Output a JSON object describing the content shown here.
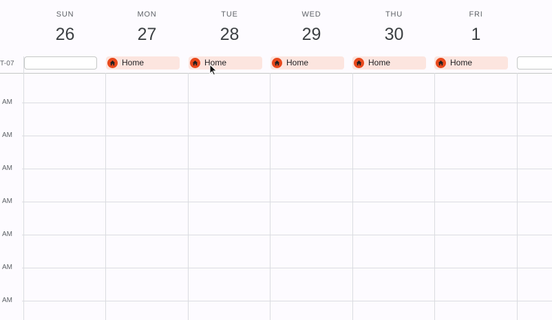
{
  "calendar": {
    "timezone_label": "T-07",
    "days": [
      {
        "name": "SUN",
        "num": "26",
        "chip": ""
      },
      {
        "name": "MON",
        "num": "27",
        "chip": "Home"
      },
      {
        "name": "TUE",
        "num": "28",
        "chip": "Home"
      },
      {
        "name": "WED",
        "num": "29",
        "chip": "Home"
      },
      {
        "name": "THU",
        "num": "30",
        "chip": "Home"
      },
      {
        "name": "FRI",
        "num": "1",
        "chip": "Home"
      },
      {
        "name": "S",
        "num": "",
        "chip": ""
      }
    ],
    "hour_labels": [
      "AM",
      "AM",
      "AM",
      "AM",
      "AM",
      "AM",
      "AM"
    ],
    "chip_icon": "home-icon",
    "colors": {
      "chip_bg": "#fce5df",
      "chip_icon_bg": "#e8491d",
      "grid_line": "#dadce0",
      "background": "#fdfbff"
    }
  }
}
